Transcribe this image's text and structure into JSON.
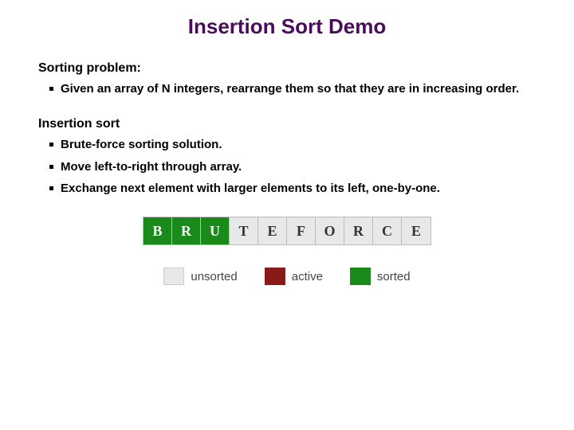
{
  "title": "Insertion Sort Demo",
  "section1": {
    "heading": "Sorting problem:",
    "bullets": [
      "Given an array of N integers, rearrange them so that they are in increasing order."
    ]
  },
  "section2": {
    "heading": "Insertion sort",
    "bullets": [
      "Brute-force sorting solution.",
      "Move left-to-right through array.",
      "Exchange next element with larger elements to its left, one-by-one."
    ]
  },
  "array": [
    {
      "v": "B",
      "state": "sorted"
    },
    {
      "v": "R",
      "state": "sorted"
    },
    {
      "v": "U",
      "state": "sorted"
    },
    {
      "v": "T",
      "state": "unsorted"
    },
    {
      "v": "E",
      "state": "unsorted"
    },
    {
      "v": "F",
      "state": "unsorted"
    },
    {
      "v": "O",
      "state": "unsorted"
    },
    {
      "v": "R",
      "state": "unsorted"
    },
    {
      "v": "C",
      "state": "unsorted"
    },
    {
      "v": "E",
      "state": "unsorted"
    }
  ],
  "legend": {
    "unsorted": "unsorted",
    "active": "active",
    "sorted": "sorted"
  },
  "colors": {
    "sorted": "#1a8a1a",
    "active": "#8a1a1a",
    "unsorted": "#e8e8e8",
    "title": "#4b0b5b"
  }
}
